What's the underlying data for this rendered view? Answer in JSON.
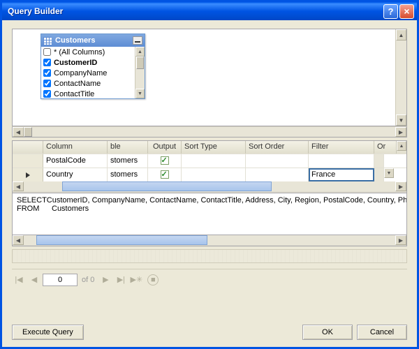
{
  "window": {
    "title": "Query Builder"
  },
  "table": {
    "name": "Customers",
    "columns": [
      {
        "label": "* (All Columns)",
        "checked": false,
        "bold": false
      },
      {
        "label": "CustomerID",
        "checked": true,
        "bold": true
      },
      {
        "label": "CompanyName",
        "checked": true,
        "bold": false
      },
      {
        "label": "ContactName",
        "checked": true,
        "bold": false
      },
      {
        "label": "ContactTitle",
        "checked": true,
        "bold": false
      }
    ]
  },
  "grid": {
    "headers": {
      "column": "Column",
      "table": "ble",
      "output": "Output",
      "sortType": "Sort Type",
      "sortOrder": "Sort Order",
      "filter": "Filter",
      "or": "Or"
    },
    "rows": [
      {
        "column": "PostalCode",
        "table": "stomers",
        "output": true,
        "filter": ""
      },
      {
        "column": "Country",
        "table": "stomers",
        "output": true,
        "filter": "France"
      }
    ]
  },
  "sql": {
    "select_kw": "SELECT",
    "select_cols": "CustomerID, CompanyName, ContactName, ContactTitle, Address, City, Region, PostalCode, Country, Ph",
    "from_kw": "FROM",
    "from_table": "Customers"
  },
  "nav": {
    "pos": "0",
    "of": "of 0"
  },
  "buttons": {
    "execute": "Execute Query",
    "ok": "OK",
    "cancel": "Cancel"
  }
}
